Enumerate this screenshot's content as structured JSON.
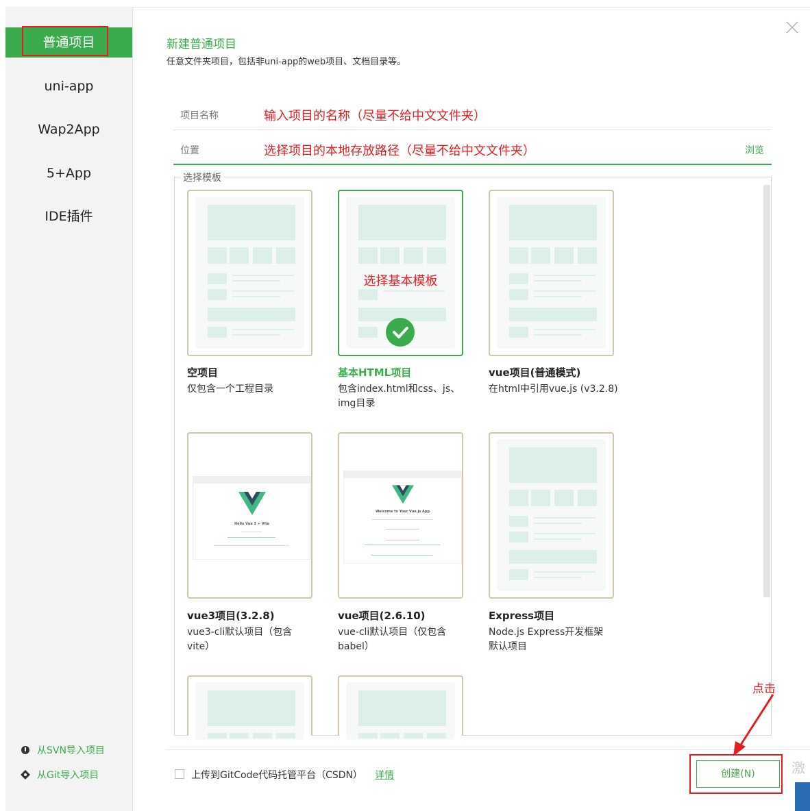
{
  "sidebar": {
    "items": [
      {
        "label": "普通项目"
      },
      {
        "label": "uni-app"
      },
      {
        "label": "Wap2App"
      },
      {
        "label": "5+App"
      },
      {
        "label": "IDE插件"
      }
    ],
    "import_svn": "从SVN导入项目",
    "import_git": "从Git导入项目"
  },
  "header": {
    "title": "新建普通项目",
    "subtitle": "任意文件夹项目，包括非uni-app的web项目、文档目录等。"
  },
  "form": {
    "name_label": "项目名称",
    "name_hint": "输入项目的名称（尽量不给中文文件夹）",
    "location_label": "位置",
    "location_hint": "选择项目的本地存放路径（尽量不给中文文件夹）",
    "browse_label": "浏览"
  },
  "templates": {
    "legend": "选择模板",
    "select_hint": "选择基本模板",
    "items": [
      {
        "title": "空项目",
        "desc": "仅包含一个工程目录"
      },
      {
        "title": "基本HTML项目",
        "desc": "包含index.html和css、js、img目录"
      },
      {
        "title": "vue项目(普通模式)",
        "desc": "在html中引用vue.js (v3.2.8)"
      },
      {
        "title": "vue3项目(3.2.8)",
        "desc": "vue3-cli默认项目（包含vite）",
        "preview": "Hello Vue 3 + Vite"
      },
      {
        "title": "vue项目(2.6.10)",
        "desc": "vue-cli默认项目（仅包含babel）",
        "preview": "Welcome to Your Vue.js App"
      },
      {
        "title": "Express项目",
        "desc": "Node.js Express开发框架默认项目"
      }
    ]
  },
  "footer": {
    "upload_label": "上传到GitCode代码托管平台（CSDN）",
    "details_label": "详情",
    "create_label": "创建(N)",
    "click_hint": "点击",
    "corner_text": "激"
  },
  "colors": {
    "accent": "#3cab4e",
    "annotation": "#e02020",
    "card_border": "#d4c7a8"
  }
}
